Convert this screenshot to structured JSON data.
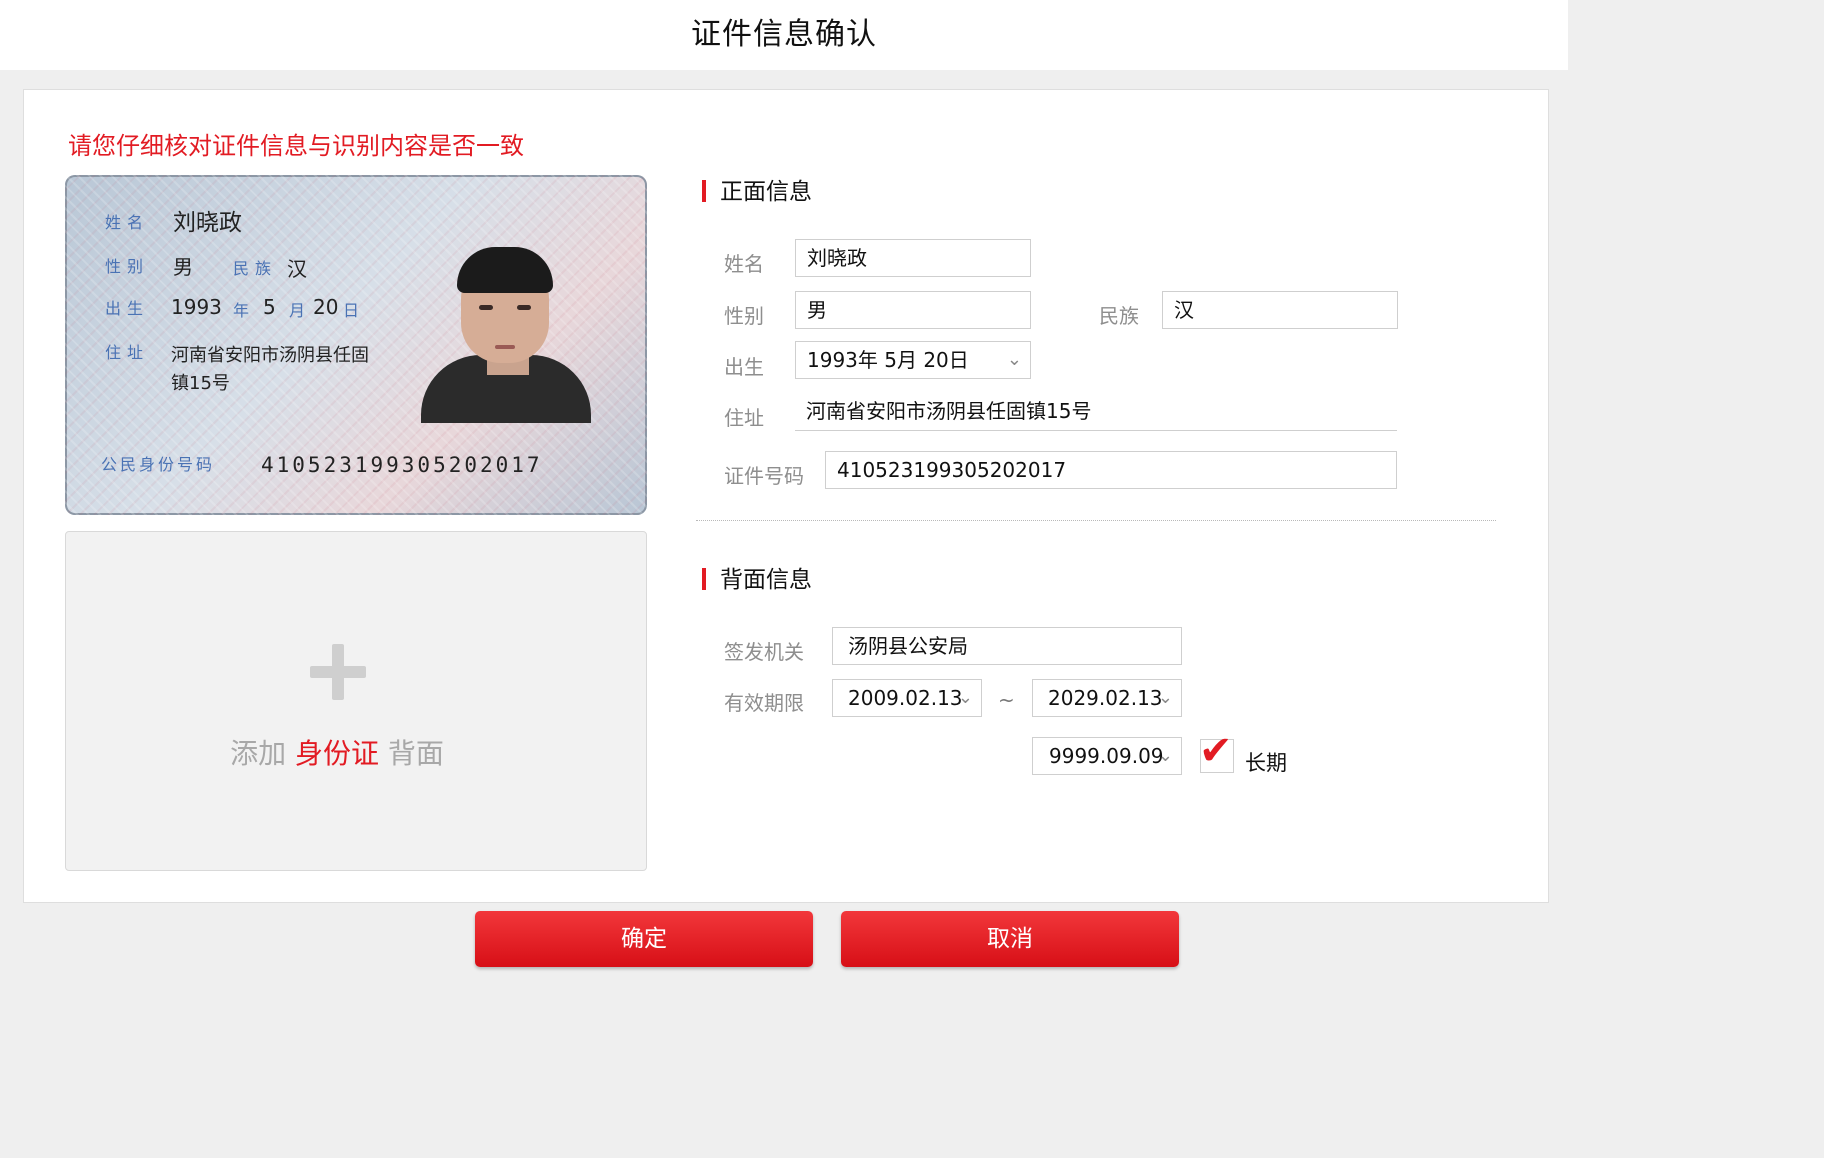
{
  "header": {
    "title": "证件信息确认"
  },
  "notice": "请您仔细核对证件信息与识别内容是否一致",
  "id_card": {
    "name_label": "姓名",
    "name_value": "刘晓政",
    "gender_label": "性别",
    "gender_value": "男",
    "ethnicity_label": "民族",
    "ethnicity_value": "汉",
    "birth_label": "出生",
    "birth_year": "1993",
    "birth_year_unit": "年",
    "birth_month": "5",
    "birth_month_unit": "月",
    "birth_day": "20",
    "birth_day_unit": "日",
    "address_label": "住址",
    "address_line1": "河南省安阳市汤阴县任固",
    "address_line2": "镇15号",
    "id_number_label": "公民身份号码",
    "id_number_value": "410523199305202017"
  },
  "upload": {
    "prefix": "添加",
    "highlight": "身份证",
    "suffix": "背面"
  },
  "front": {
    "section_title": "正面信息",
    "name_label": "姓名",
    "name_value": "刘晓政",
    "gender_label": "性别",
    "gender_value": "男",
    "ethnicity_label": "民族",
    "ethnicity_value": "汉",
    "birth_label": "出生",
    "birth_value": "1993年 5月 20日",
    "address_label": "住址",
    "address_value": "河南省安阳市汤阴县任固镇15号",
    "id_label": "证件号码",
    "id_value": "410523199305202017"
  },
  "back": {
    "section_title": "背面信息",
    "authority_label": "签发机关",
    "authority_value": "汤阴县公安局",
    "validity_label": "有效期限",
    "start_date": "2009.02.13",
    "separator": "~",
    "end_date": "2029.02.13",
    "long_term_date": "9999.09.09",
    "long_term_label": "长期",
    "long_term_checked": true
  },
  "buttons": {
    "confirm": "确定",
    "cancel": "取消"
  },
  "colors": {
    "accent": "#e21b23",
    "label": "#8e8e8e",
    "background": "#efefef"
  },
  "icons": {
    "dropdown": "chevron-down-icon",
    "add": "plus-icon",
    "check": "checkmark-icon"
  }
}
